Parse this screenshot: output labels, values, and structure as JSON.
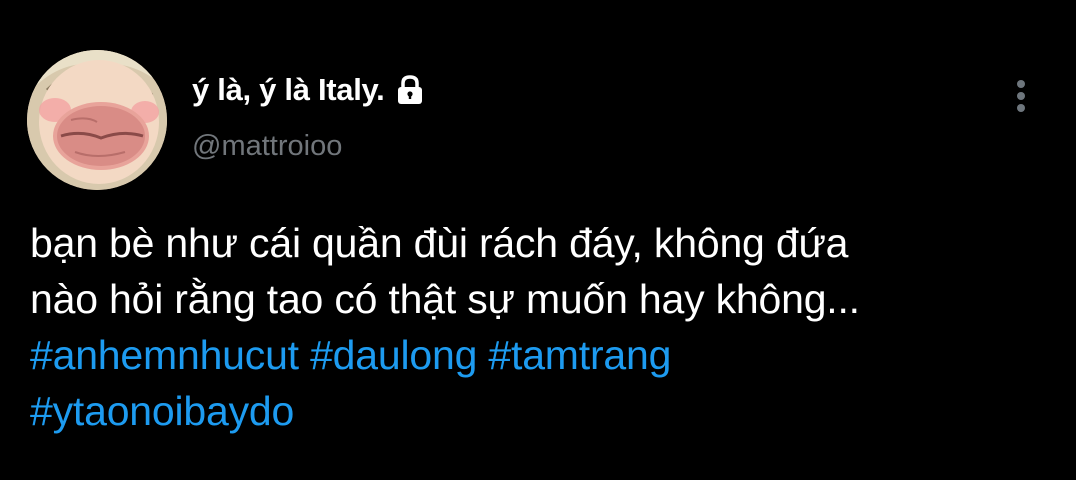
{
  "author": {
    "display_name": "ý là, ý là Italy.",
    "handle": "@mattroioo",
    "avatar_icon": "cartoon-kiss-face-avatar",
    "protected_icon": "lock-icon"
  },
  "menu": {
    "icon": "more-vertical-icon"
  },
  "tweet": {
    "text_line_1": "bạn bè như cái quần đùi rách đáy, không đứa",
    "text_line_2": "nào hỏi rằng tao có thật sự muốn hay không...",
    "hashtags": [
      "#anhemnhucut",
      "#daulong",
      "#tamtrang",
      "#ytaonoibaydo"
    ]
  },
  "colors": {
    "background": "#000000",
    "text": "#ffffff",
    "secondary": "#71767b",
    "hashtag": "#1d9bf0"
  }
}
